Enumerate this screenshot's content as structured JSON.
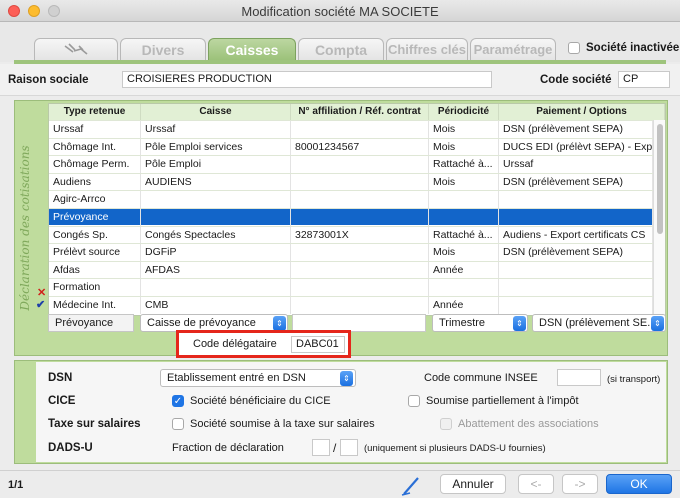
{
  "window": {
    "title": "Modification société MA SOCIETE"
  },
  "tabs": [
    {
      "label": "",
      "icon": "satellite-icon"
    },
    {
      "label": "Divers"
    },
    {
      "label": "Caisses"
    },
    {
      "label": "Compta"
    },
    {
      "label": "Chiffres clés"
    },
    {
      "label": "Paramétrage"
    }
  ],
  "inactive_label": "Société inactivée",
  "raison_sociale": {
    "label": "Raison sociale",
    "value": "CROISIERES PRODUCTION"
  },
  "code_societe": {
    "label": "Code société",
    "value": "CP"
  },
  "decl_side_label": "Déclaration des cotisations",
  "grid": {
    "headers": [
      "Type retenue",
      "Caisse",
      "N° affiliation / Réf. contrat",
      "Périodicité",
      "Paiement / Options"
    ],
    "rows": [
      [
        "Urssaf",
        "Urssaf",
        "",
        "Mois",
        "DSN (prélèvement SEPA)"
      ],
      [
        "Chômage Int.",
        "Pôle Emploi services",
        "80001234567",
        "Mois",
        "DUCS EDI (prélèvt SEPA) - Exp. AEM"
      ],
      [
        "Chômage Perm.",
        "Pôle Emploi",
        "",
        "Rattaché à...",
        "Urssaf"
      ],
      [
        "Audiens",
        "AUDIENS",
        "",
        "Mois",
        "DSN (prélèvement SEPA)"
      ],
      [
        "Agirc-Arrco",
        "",
        "",
        "",
        ""
      ],
      [
        "Prévoyance",
        "",
        "",
        "",
        ""
      ],
      [
        "Congés Sp.",
        "Congés Spectacles",
        "32873001X",
        "Rattaché à...",
        "Audiens - Export certificats CS"
      ],
      [
        "Prélèvt source",
        "DGFiP",
        "",
        "Mois",
        "DSN (prélèvement SEPA)"
      ],
      [
        "Afdas",
        "AFDAS",
        "",
        "Année",
        ""
      ],
      [
        "Formation",
        "",
        "",
        "",
        ""
      ],
      [
        "Médecine Int.",
        "CMB",
        "",
        "Année",
        ""
      ]
    ]
  },
  "edit_row": {
    "type": "Prévoyance",
    "caisse": "Caisse de prévoyance",
    "affiliation": "",
    "periodicite": "Trimestre",
    "paiement": "DSN (prélèvement SE..."
  },
  "code_delegataire": {
    "label": "Code délégataire",
    "value": "DABC01"
  },
  "dsn": {
    "label": "DSN",
    "value": "Etablissement entré en DSN",
    "insee_label": "Code commune INSEE",
    "insee_value": "",
    "insee_note": "(si transport)"
  },
  "cice": {
    "label": "CICE",
    "check_label": "Société bénéficiaire du CICE",
    "partial_label": "Soumise partiellement à l'impôt"
  },
  "taxe": {
    "label": "Taxe sur salaires",
    "check_label": "Société soumise à la taxe sur salaires",
    "abattement_label": "Abattement des associations"
  },
  "dadsu": {
    "label": "DADS-U",
    "fraction_label": "Fraction de déclaration",
    "num": "",
    "sep": "/",
    "den": "",
    "note": "(uniquement si plusieurs DADS-U fournies)"
  },
  "footer": {
    "page": "1/1",
    "cancel": "Annuler",
    "prev": "<-",
    "next": "->",
    "ok": "OK"
  },
  "colors": {
    "accent_green": "#9ec47c",
    "selection_blue": "#1265c9",
    "highlight_red": "#e5261b",
    "ok_blue": "#1f75e5"
  }
}
